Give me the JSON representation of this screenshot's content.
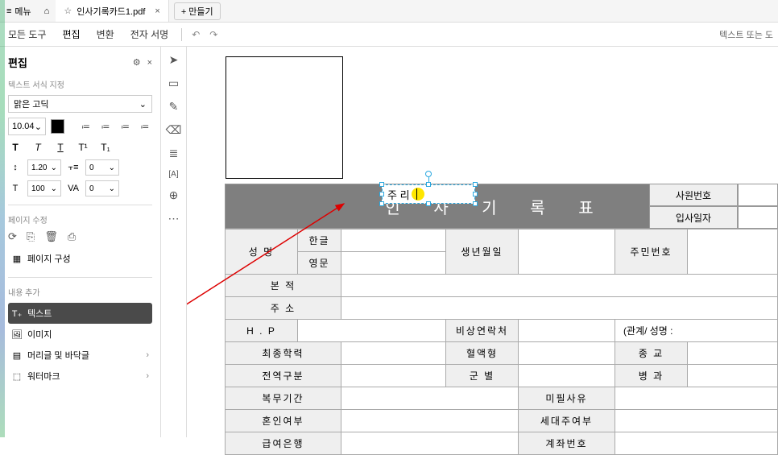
{
  "titlebar": {
    "menu_label": "메뉴",
    "tab_title": "인사기록카드1.pdf",
    "new_tab_label": "+ 만들기"
  },
  "toolbar": {
    "all_tools": "모든 도구",
    "edit": "편집",
    "convert": "변환",
    "esign": "전자 서명",
    "right_hint": "텍스트 또는 도"
  },
  "panel": {
    "title": "편집",
    "text_format_label": "텍스트 서식 지정",
    "font_name": "맑은 고딕",
    "font_size": "10.04",
    "line_height_icon": "↕",
    "line_height": "1.20",
    "char_spacing": "0",
    "tracking_icon": "T",
    "tracking": "100",
    "va": "VA",
    "va_val": "0",
    "page_edit_label": "페이지 수정",
    "page_layout": "페이지 구성",
    "content_add_label": "내용 추가",
    "items": {
      "text": "텍스트",
      "image": "이미지",
      "header_footer": "머리글 및 바닥글",
      "watermark": "워터마크"
    },
    "list_icons": [
      "≔",
      "≔",
      "≔",
      "≔"
    ]
  },
  "format": {
    "bold": "T",
    "italic": "T",
    "underline": "T",
    "super": "T¹",
    "sub": "T₁"
  },
  "edit_box": {
    "text": "주 리"
  },
  "form": {
    "title": "인 사 기 록 표",
    "side": {
      "emp_no": "사원번호",
      "hire_date": "입사일자"
    },
    "rows": {
      "name": "성  명",
      "name_kor": "한글",
      "name_eng": "영문",
      "birth": "생년월일",
      "ssn": "주민번호",
      "domicile": "본  적",
      "address": "주  소",
      "hp": "H . P",
      "emergency": "비상연락처",
      "relation": "(관계/ 성명 :",
      "edu": "최종학력",
      "blood": "혈액형",
      "religion": "종  교",
      "discharge": "전역구분",
      "branch": "군  별",
      "mos": "병  과",
      "service": "복무기간",
      "exemption": "미필사유",
      "marriage": "혼인여부",
      "householder": "세대주여부",
      "bank": "급여은행",
      "account": "계좌번호"
    }
  }
}
